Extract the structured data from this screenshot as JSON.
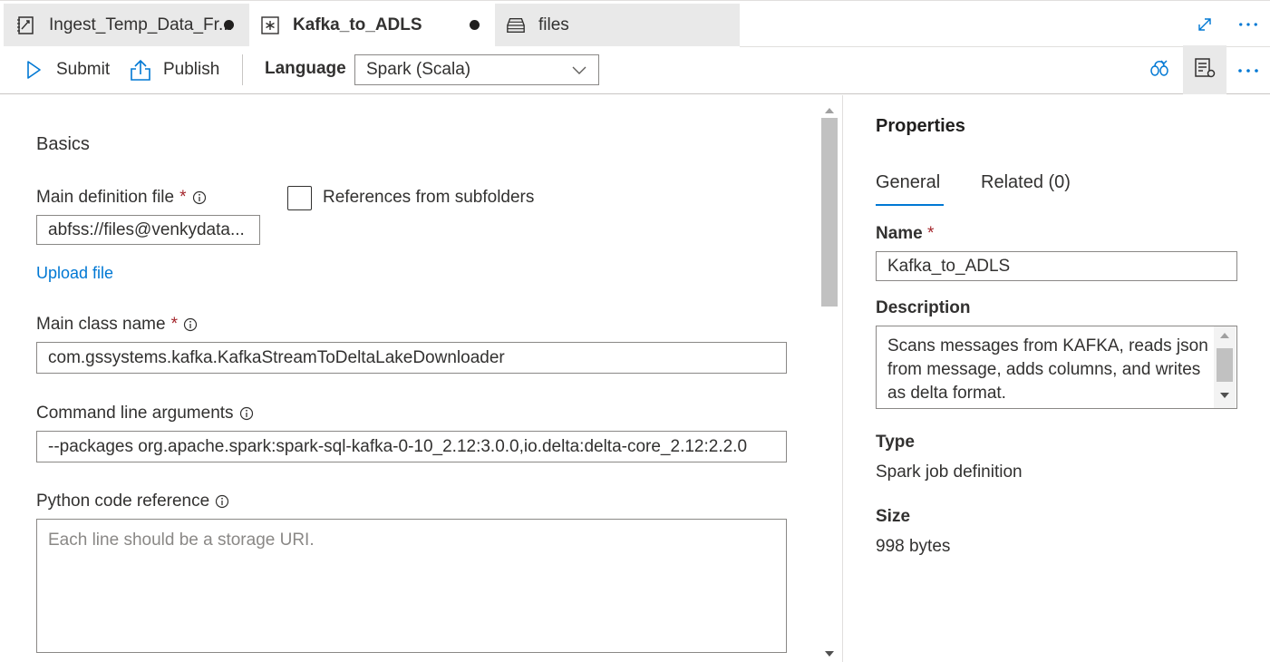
{
  "tabs": [
    {
      "label": "Ingest_Temp_Data_Fr...",
      "icon": "notebook-icon",
      "unsaved": true
    },
    {
      "label": "Kafka_to_ADLS",
      "icon": "spark-job-icon",
      "unsaved": true
    },
    {
      "label": "files",
      "icon": "storage-icon",
      "unsaved": false
    }
  ],
  "toolbar": {
    "submit_label": "Submit",
    "publish_label": "Publish",
    "language_label": "Language",
    "language_value": "Spark (Scala)"
  },
  "form": {
    "section_title": "Basics",
    "main_def_label": "Main definition file",
    "required_mark": "*",
    "references_label": "References from subfolders",
    "main_def_value": "abfss://files@venkydata...",
    "upload_label": "Upload file",
    "main_class_label": "Main class name",
    "main_class_value": "com.gssystems.kafka.KafkaStreamToDeltaLakeDownloader",
    "cmd_label": "Command line arguments",
    "cmd_value": "--packages org.apache.spark:spark-sql-kafka-0-10_2.12:3.0.0,io.delta:delta-core_2.12:2.2.0",
    "python_label": "Python code reference",
    "python_placeholder": "Each line should be a storage URI."
  },
  "properties": {
    "title": "Properties",
    "tab_general": "General",
    "tab_related": "Related (0)",
    "name_label": "Name",
    "name_value": "Kafka_to_ADLS",
    "description_label": "Description",
    "description_value": "Scans messages from KAFKA, reads json from message, adds columns, and writes as delta format.",
    "type_label": "Type",
    "type_value": "Spark job definition",
    "size_label": "Size",
    "size_value": "998 bytes"
  },
  "colors": {
    "accent": "#0078d4",
    "required": "#a4262c",
    "inactive_tab": "#e9e9e9"
  }
}
